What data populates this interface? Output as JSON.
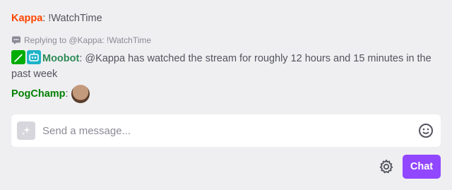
{
  "messages": [
    {
      "user": "Kappa",
      "user_color": "#ff4500",
      "text": ": !WatchTime"
    },
    {
      "reply_context": "Replying to @Kappa: !WatchTime",
      "user": "Moobot",
      "user_color": "#2e8b57",
      "text": ": @Kappa has watched the stream for roughly 12 hours and 15 minutes in the past week"
    },
    {
      "user": "PogChamp",
      "user_color": "#008000",
      "text": ":"
    }
  ],
  "input": {
    "placeholder": "Send a message..."
  },
  "controls": {
    "chat_label": "Chat"
  },
  "colors": {
    "accent": "#9147ff",
    "background": "#efeff1"
  }
}
